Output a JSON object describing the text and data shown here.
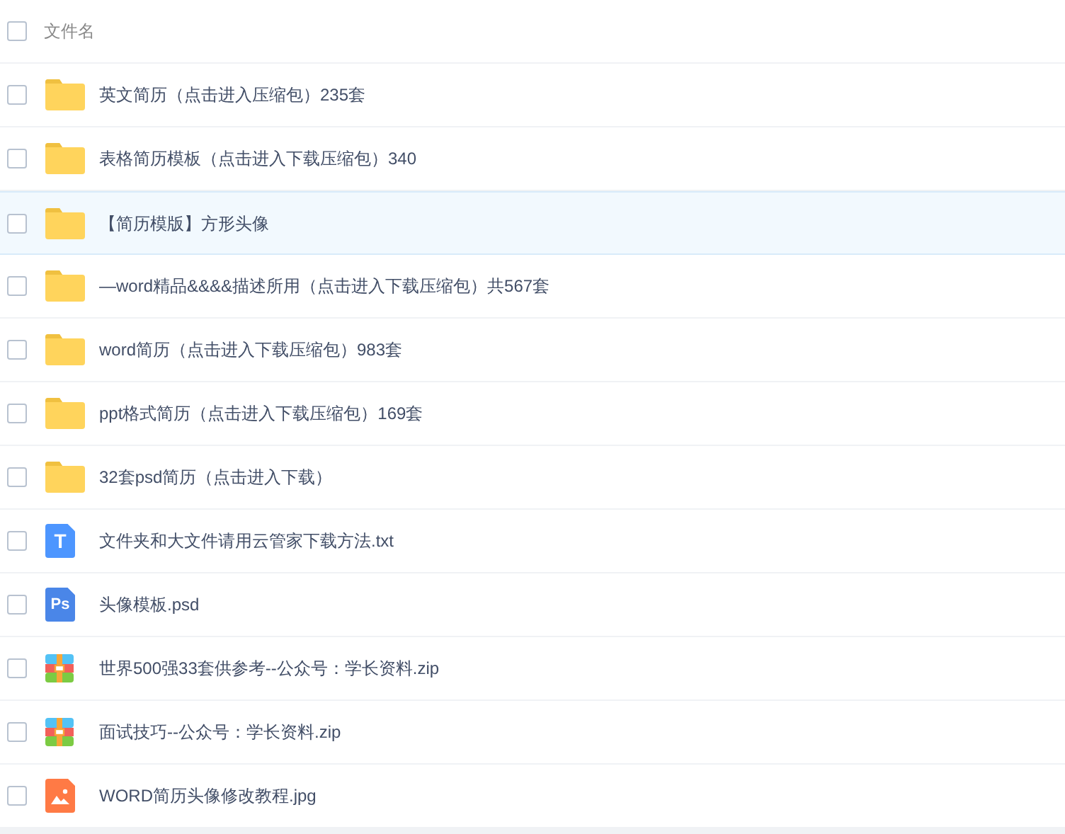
{
  "header": {
    "label": "文件名",
    "checked": false
  },
  "files": [
    {
      "kind": "folder",
      "name": "英文简历（点击进入压缩包）235套",
      "checked": false,
      "hovered": false
    },
    {
      "kind": "folder",
      "name": "表格简历模板（点击进入下载压缩包）340",
      "checked": false,
      "hovered": false
    },
    {
      "kind": "folder",
      "name": "【简历模版】方形头像",
      "checked": false,
      "hovered": true
    },
    {
      "kind": "folder",
      "name": "—word精品&&&&描述所用（点击进入下载压缩包）共567套",
      "checked": false,
      "hovered": false
    },
    {
      "kind": "folder",
      "name": "word简历（点击进入下载压缩包）983套",
      "checked": false,
      "hovered": false
    },
    {
      "kind": "folder",
      "name": "ppt格式简历（点击进入下载压缩包）169套",
      "checked": false,
      "hovered": false
    },
    {
      "kind": "folder",
      "name": "32套psd简历（点击进入下载）",
      "checked": false,
      "hovered": false
    },
    {
      "kind": "text",
      "icon_label": "T",
      "name": "文件夹和大文件请用云管家下载方法.txt",
      "checked": false,
      "hovered": false
    },
    {
      "kind": "psd",
      "icon_label": "Ps",
      "name": "头像模板.psd",
      "checked": false,
      "hovered": false
    },
    {
      "kind": "zip",
      "name": "世界500强33套供参考--公众号：学长资料.zip",
      "checked": false,
      "hovered": false
    },
    {
      "kind": "zip",
      "name": "面试技巧--公众号：学长资料.zip",
      "checked": false,
      "hovered": false
    },
    {
      "kind": "image",
      "name": "WORD简历头像修改教程.jpg",
      "checked": false,
      "hovered": false
    }
  ]
}
